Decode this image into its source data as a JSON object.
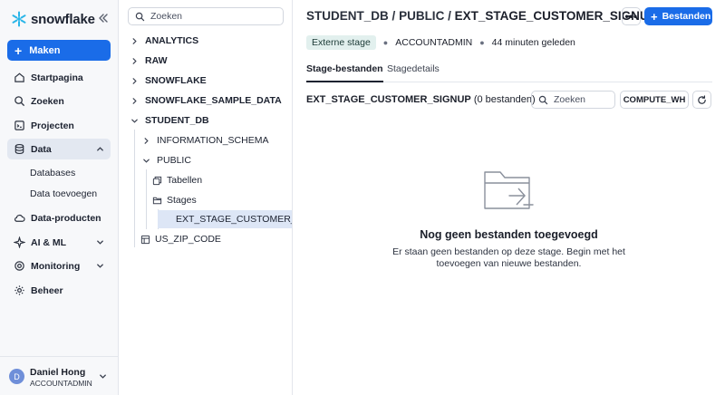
{
  "nav": {
    "logo_text": "snowflake",
    "create_label": "Maken",
    "items": [
      {
        "label": "Startpagina",
        "icon": "home-icon"
      },
      {
        "label": "Zoeken",
        "icon": "search-icon"
      },
      {
        "label": "Projecten",
        "icon": "projects-icon"
      },
      {
        "label": "Data",
        "icon": "database-icon"
      },
      {
        "label": "Data-producten",
        "icon": "cloud-icon"
      },
      {
        "label": "AI & ML",
        "icon": "ai-icon"
      },
      {
        "label": "Monitoring",
        "icon": "monitoring-icon"
      },
      {
        "label": "Beheer",
        "icon": "gear-icon"
      }
    ],
    "data_sub": [
      "Databases",
      "Data toevoegen"
    ],
    "user": {
      "initial": "D",
      "name": "Daniel Hong",
      "role": "ACCOUNTADMIN"
    }
  },
  "tree": {
    "search_placeholder": "Zoeken",
    "databases": [
      "ANALYTICS",
      "RAW",
      "SNOWFLAKE",
      "SNOWFLAKE_SAMPLE_DATA",
      "STUDENT_DB"
    ],
    "schemas": [
      "INFORMATION_SCHEMA",
      "PUBLIC"
    ],
    "public_children": [
      "Tabellen",
      "Stages"
    ],
    "stage_item": "EXT_STAGE_CUSTOMER_SIGNUP",
    "other_item": "US_ZIP_CODE"
  },
  "main": {
    "crumb_db": "STUDENT_DB",
    "crumb_schema": "PUBLIC",
    "crumb_sep": "/",
    "crumb_current": "EXT_STAGE_CUSTOMER_SIGNUP",
    "files_button": "Bestanden",
    "meta": {
      "badge": "Externe stage",
      "owner": "ACCOUNTADMIN",
      "time": "44 minuten geleden"
    },
    "tabs": [
      "Stage-bestanden",
      "Stagedetails"
    ],
    "section_name": "EXT_STAGE_CUSTOMER_SIGNUP",
    "section_count": "(0 bestanden)",
    "search_placeholder": "Zoeken",
    "warehouse": "COMPUTE_WH",
    "empty_title": "Nog geen bestanden toegevoegd",
    "empty_desc": "Er staan geen bestanden op deze stage. Begin met het toevoegen van nieuwe bestanden."
  },
  "colors": {
    "accent": "#1a6ce8",
    "nav_bg": "#f7f8fa",
    "selected_bg": "#dde6f6",
    "badge_bg": "#e2f0ee"
  }
}
